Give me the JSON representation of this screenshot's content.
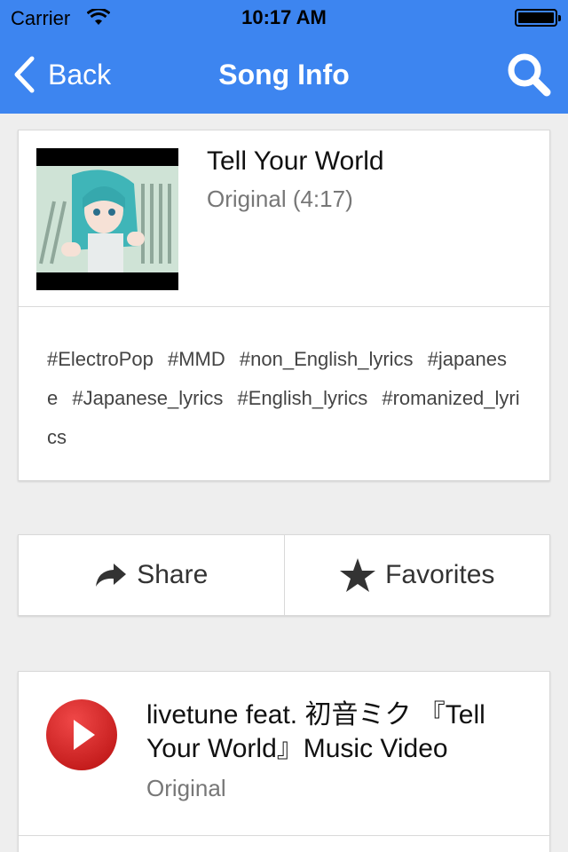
{
  "status_bar": {
    "carrier": "Carrier",
    "time": "10:17 AM",
    "battery_level": 1.0
  },
  "nav": {
    "back_label": "Back",
    "title": "Song Info",
    "search_icon": "search-icon",
    "back_icon": "chevron-left-icon"
  },
  "song": {
    "title": "Tell Your World",
    "subtitle": "Original (4:17)",
    "thumbnail_icon": "video-thumbnail",
    "tags": [
      "#ElectroPop",
      "#MMD",
      "#non_English_lyrics",
      "#japanese",
      "#Japanese_lyrics",
      "#English_lyrics",
      "#romanized_lyrics"
    ]
  },
  "actions": {
    "share_label": "Share",
    "share_icon": "share-arrow-icon",
    "favorites_label": "Favorites",
    "favorites_icon": "star-icon"
  },
  "video": {
    "title": "livetune feat. 初音ミク 『Tell Your World』Music Video",
    "subtitle": "Original",
    "icon": "youtube-play-icon"
  },
  "colors": {
    "nav_bar": "#3d85f0",
    "background": "#eeeeee",
    "play_button": "#d62424"
  }
}
